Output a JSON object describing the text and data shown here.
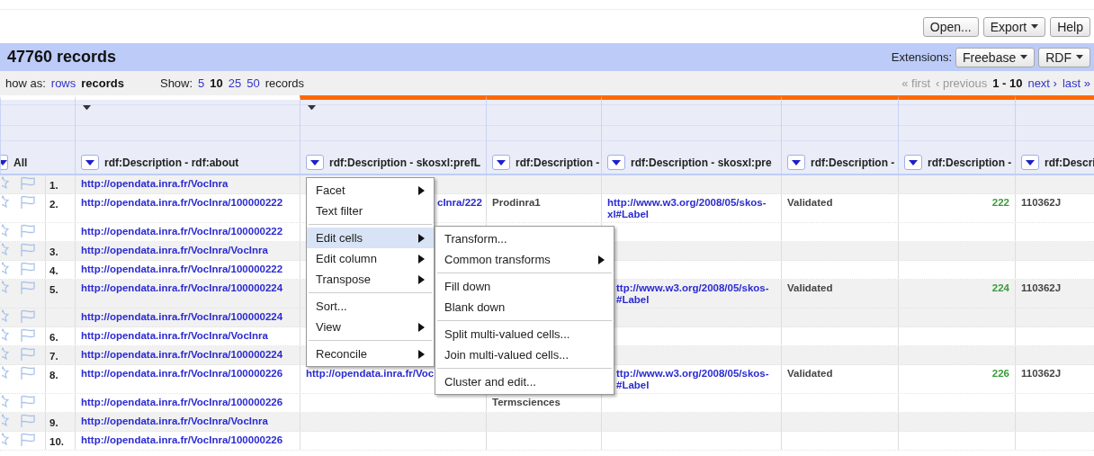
{
  "toolbar": {
    "buttons": [
      {
        "label": "Open...",
        "dropdown": false
      },
      {
        "label": "Export",
        "dropdown": true
      },
      {
        "label": "Help",
        "dropdown": false
      }
    ]
  },
  "summary": {
    "title": "47760 records",
    "extensions_label": "Extensions:",
    "extensions": [
      {
        "label": "Freebase",
        "dropdown": true
      },
      {
        "label": "RDF",
        "dropdown": true
      }
    ]
  },
  "view_bar": {
    "show_as_label": "how as:",
    "modes": [
      {
        "label": "rows",
        "selected": false
      },
      {
        "label": "records",
        "selected": true
      }
    ],
    "show_label": "Show:",
    "page_sizes": [
      {
        "label": "5",
        "selected": false
      },
      {
        "label": "10",
        "selected": true
      },
      {
        "label": "25",
        "selected": false
      },
      {
        "label": "50",
        "selected": false
      }
    ],
    "page_sizes_suffix": "records",
    "pager": [
      {
        "label": "« first",
        "kind": "disabled"
      },
      {
        "label": "‹ previous",
        "kind": "disabled"
      },
      {
        "label": "1 - 10",
        "kind": "current"
      },
      {
        "label": "next ›",
        "kind": "link"
      },
      {
        "label": "last »",
        "kind": "link"
      }
    ]
  },
  "table": {
    "columns": [
      {
        "label": "All",
        "kind": "index",
        "group_arrow": false,
        "in_group": false
      },
      {
        "label": "rdf:Description - rdf:about",
        "kind": "link",
        "group_arrow": true,
        "in_group": false
      },
      {
        "label": "rdf:Description - skosxl:prefL",
        "kind": "link",
        "group_arrow": true,
        "in_group": true
      },
      {
        "label": "rdf:Description -",
        "kind": "text",
        "group_arrow": false,
        "in_group": true
      },
      {
        "label": "rdf:Description - skosxl:pre",
        "kind": "link",
        "group_arrow": false,
        "in_group": true
      },
      {
        "label": "rdf:Description -",
        "kind": "text",
        "group_arrow": false,
        "in_group": true
      },
      {
        "label": "rdf:Description -",
        "kind": "number",
        "group_arrow": false,
        "in_group": true
      },
      {
        "label": "rdf:Descri",
        "kind": "text",
        "group_arrow": false,
        "in_group": true
      }
    ],
    "rows": [
      {
        "shaded": true,
        "cells": [
          "1.",
          "http://opendata.inra.fr/VocInra",
          "",
          "",
          "",
          "",
          "",
          ""
        ]
      },
      {
        "shaded": false,
        "cells": [
          "2.",
          "http://opendata.inra.fr/VocInra/100000222",
          {
            "text": "cInra/222",
            "clipped": true
          },
          "Prodinra1",
          "http://www.w3.org/2008/05/skos-\nxl#Label",
          "Validated",
          "222",
          "110362J"
        ]
      },
      {
        "shaded": false,
        "cells": [
          "",
          "http://opendata.inra.fr/VocInra/100000222",
          "",
          "",
          "",
          "",
          "",
          ""
        ]
      },
      {
        "shaded": true,
        "cells": [
          "3.",
          "http://opendata.inra.fr/VocInra/VocInra",
          "",
          "",
          "",
          "",
          "",
          ""
        ]
      },
      {
        "shaded": false,
        "cells": [
          "4.",
          "http://opendata.inra.fr/VocInra/100000222",
          "",
          "",
          "",
          "",
          "",
          ""
        ]
      },
      {
        "shaded": true,
        "cells": [
          "5.",
          "http://opendata.inra.fr/VocInra/100000224",
          "",
          "",
          {
            "text": "ttp://www.w3.org/2008/05/skos-\n#Label",
            "clipped": true
          },
          "Validated",
          "224",
          "110362J"
        ]
      },
      {
        "shaded": true,
        "cells": [
          "",
          "http://opendata.inra.fr/VocInra/100000224",
          "",
          "",
          "",
          "",
          "",
          ""
        ]
      },
      {
        "shaded": false,
        "cells": [
          "6.",
          "http://opendata.inra.fr/VocInra/VocInra",
          "",
          "",
          "",
          "",
          "",
          ""
        ]
      },
      {
        "shaded": true,
        "cells": [
          "7.",
          "http://opendata.inra.fr/VocInra/100000224",
          "",
          "",
          "",
          "",
          "",
          ""
        ]
      },
      {
        "shaded": false,
        "cells": [
          "8.",
          "http://opendata.inra.fr/VocInra/100000226",
          "http://opendata.inra.fr/Voc",
          "",
          {
            "text": "ttp://www.w3.org/2008/05/skos-\n#Label",
            "clipped": true
          },
          "Validated",
          "226",
          "110362J"
        ]
      },
      {
        "shaded": false,
        "cells": [
          "",
          "http://opendata.inra.fr/VocInra/100000226",
          "",
          "Termsciences",
          "",
          "",
          "",
          ""
        ]
      },
      {
        "shaded": true,
        "cells": [
          "9.",
          "http://opendata.inra.fr/VocInra/VocInra",
          "",
          "",
          "",
          "",
          "",
          ""
        ]
      },
      {
        "shaded": false,
        "cells": [
          "10.",
          "http://opendata.inra.fr/VocInra/100000226",
          "",
          "",
          "",
          "",
          "",
          ""
        ]
      }
    ]
  },
  "column_menu": {
    "items": [
      {
        "kind": "item",
        "label": "Facet",
        "submenu": true,
        "highlighted": false
      },
      {
        "kind": "item",
        "label": "Text filter",
        "submenu": false,
        "highlighted": false
      },
      {
        "kind": "separator"
      },
      {
        "kind": "item",
        "label": "Edit cells",
        "submenu": true,
        "highlighted": true
      },
      {
        "kind": "item",
        "label": "Edit column",
        "submenu": true,
        "highlighted": false
      },
      {
        "kind": "item",
        "label": "Transpose",
        "submenu": true,
        "highlighted": false
      },
      {
        "kind": "separator"
      },
      {
        "kind": "item",
        "label": "Sort...",
        "submenu": false,
        "highlighted": false
      },
      {
        "kind": "item",
        "label": "View",
        "submenu": true,
        "highlighted": false
      },
      {
        "kind": "separator"
      },
      {
        "kind": "item",
        "label": "Reconcile",
        "submenu": true,
        "highlighted": false
      }
    ]
  },
  "edit_cells_menu": {
    "items": [
      {
        "kind": "item",
        "label": "Transform...",
        "submenu": false,
        "highlighted": false
      },
      {
        "kind": "item",
        "label": "Common transforms",
        "submenu": true,
        "highlighted": false
      },
      {
        "kind": "separator"
      },
      {
        "kind": "item",
        "label": "Fill down",
        "submenu": false,
        "highlighted": false
      },
      {
        "kind": "item",
        "label": "Blank down",
        "submenu": false,
        "highlighted": false
      },
      {
        "kind": "separator"
      },
      {
        "kind": "item",
        "label": "Split multi-valued cells...",
        "submenu": false,
        "highlighted": false
      },
      {
        "kind": "item",
        "label": "Join multi-valued cells...",
        "submenu": false,
        "highlighted": false
      },
      {
        "kind": "separator"
      },
      {
        "kind": "item",
        "label": "Cluster and edit...",
        "submenu": false,
        "highlighted": false
      }
    ]
  }
}
